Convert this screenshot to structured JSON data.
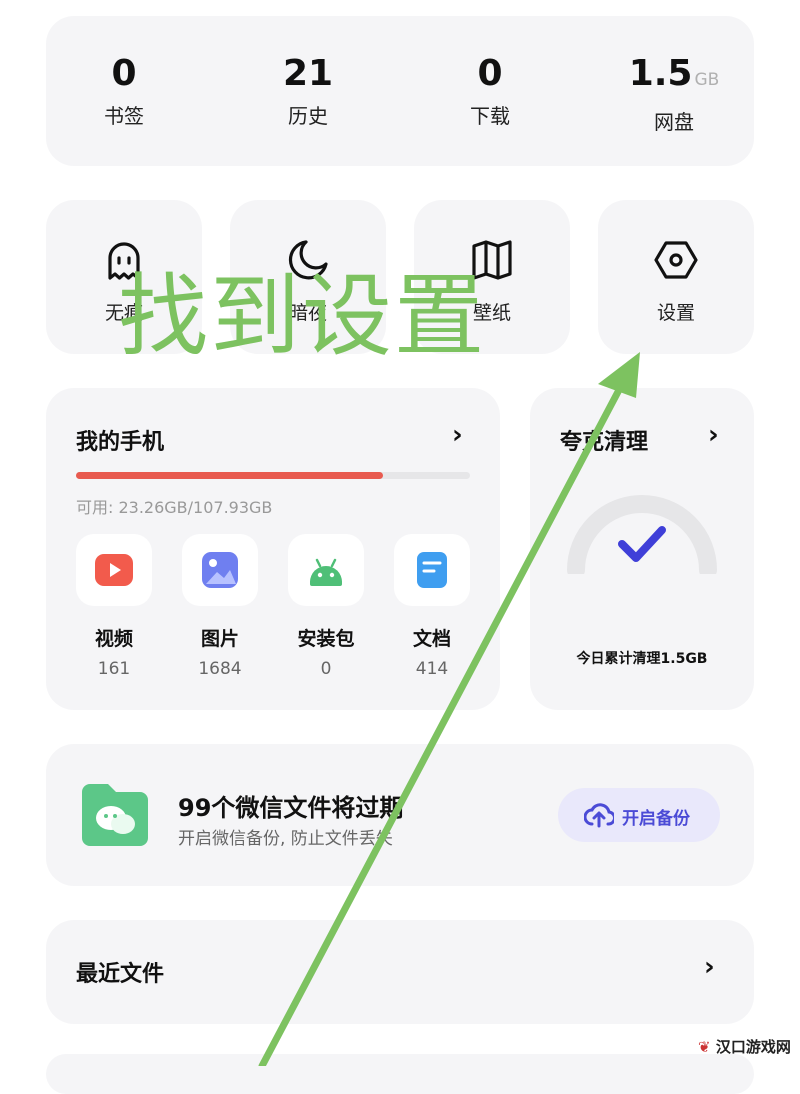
{
  "stats": [
    {
      "value": "0",
      "unit": "",
      "label": "书签"
    },
    {
      "value": "21",
      "unit": "",
      "label": "历史"
    },
    {
      "value": "0",
      "unit": "",
      "label": "下载"
    },
    {
      "value": "1.5",
      "unit": "GB",
      "label": "网盘"
    }
  ],
  "tools": [
    {
      "label": "无痕",
      "icon": "ghost-icon"
    },
    {
      "label": "暗夜",
      "icon": "moon-icon"
    },
    {
      "label": "壁纸",
      "icon": "wallpaper-icon"
    },
    {
      "label": "设置",
      "icon": "hexagon-gear-icon"
    }
  ],
  "phone": {
    "title": "我的手机",
    "available": "可用: 23.26GB/107.93GB",
    "usage_fraction": 0.78,
    "categories": [
      {
        "name": "视频",
        "count": "161",
        "icon": "video-icon",
        "color": "#f25b4c"
      },
      {
        "name": "图片",
        "count": "1684",
        "icon": "image-icon",
        "color": "#6f7ff0"
      },
      {
        "name": "安装包",
        "count": "0",
        "icon": "android-icon",
        "color": "#4fbf77"
      },
      {
        "name": "文档",
        "count": "414",
        "icon": "document-icon",
        "color": "#3f9ef0"
      }
    ]
  },
  "clean": {
    "title": "夸克清理",
    "total": "今日累计清理1.5GB"
  },
  "wechat": {
    "title": "99个微信文件将过期",
    "subtitle": "开启微信备份, 防止文件丢失",
    "button": "开启备份"
  },
  "recent": {
    "title": "最近文件"
  },
  "annotation": {
    "text": "找到设置",
    "color": "#7dc260"
  },
  "watermark": "汉口游戏网"
}
